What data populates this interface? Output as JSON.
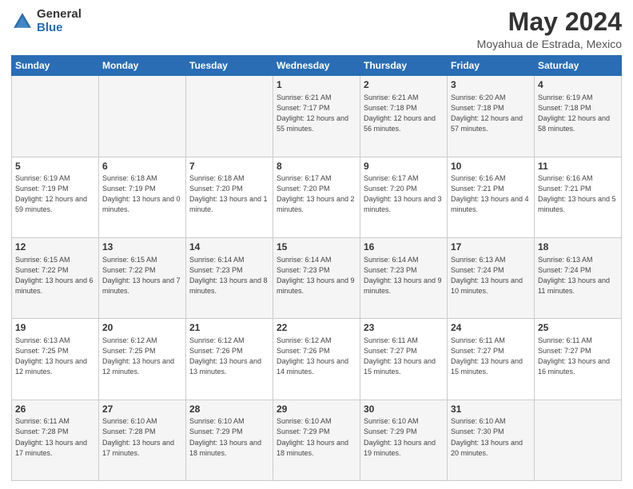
{
  "logo": {
    "general": "General",
    "blue": "Blue"
  },
  "title": "May 2024",
  "subtitle": "Moyahua de Estrada, Mexico",
  "days_header": [
    "Sunday",
    "Monday",
    "Tuesday",
    "Wednesday",
    "Thursday",
    "Friday",
    "Saturday"
  ],
  "weeks": [
    [
      {
        "num": "",
        "sunrise": "",
        "sunset": "",
        "daylight": ""
      },
      {
        "num": "",
        "sunrise": "",
        "sunset": "",
        "daylight": ""
      },
      {
        "num": "",
        "sunrise": "",
        "sunset": "",
        "daylight": ""
      },
      {
        "num": "1",
        "sunrise": "Sunrise: 6:21 AM",
        "sunset": "Sunset: 7:17 PM",
        "daylight": "Daylight: 12 hours and 55 minutes."
      },
      {
        "num": "2",
        "sunrise": "Sunrise: 6:21 AM",
        "sunset": "Sunset: 7:18 PM",
        "daylight": "Daylight: 12 hours and 56 minutes."
      },
      {
        "num": "3",
        "sunrise": "Sunrise: 6:20 AM",
        "sunset": "Sunset: 7:18 PM",
        "daylight": "Daylight: 12 hours and 57 minutes."
      },
      {
        "num": "4",
        "sunrise": "Sunrise: 6:19 AM",
        "sunset": "Sunset: 7:18 PM",
        "daylight": "Daylight: 12 hours and 58 minutes."
      }
    ],
    [
      {
        "num": "5",
        "sunrise": "Sunrise: 6:19 AM",
        "sunset": "Sunset: 7:19 PM",
        "daylight": "Daylight: 12 hours and 59 minutes."
      },
      {
        "num": "6",
        "sunrise": "Sunrise: 6:18 AM",
        "sunset": "Sunset: 7:19 PM",
        "daylight": "Daylight: 13 hours and 0 minutes."
      },
      {
        "num": "7",
        "sunrise": "Sunrise: 6:18 AM",
        "sunset": "Sunset: 7:20 PM",
        "daylight": "Daylight: 13 hours and 1 minute."
      },
      {
        "num": "8",
        "sunrise": "Sunrise: 6:17 AM",
        "sunset": "Sunset: 7:20 PM",
        "daylight": "Daylight: 13 hours and 2 minutes."
      },
      {
        "num": "9",
        "sunrise": "Sunrise: 6:17 AM",
        "sunset": "Sunset: 7:20 PM",
        "daylight": "Daylight: 13 hours and 3 minutes."
      },
      {
        "num": "10",
        "sunrise": "Sunrise: 6:16 AM",
        "sunset": "Sunset: 7:21 PM",
        "daylight": "Daylight: 13 hours and 4 minutes."
      },
      {
        "num": "11",
        "sunrise": "Sunrise: 6:16 AM",
        "sunset": "Sunset: 7:21 PM",
        "daylight": "Daylight: 13 hours and 5 minutes."
      }
    ],
    [
      {
        "num": "12",
        "sunrise": "Sunrise: 6:15 AM",
        "sunset": "Sunset: 7:22 PM",
        "daylight": "Daylight: 13 hours and 6 minutes."
      },
      {
        "num": "13",
        "sunrise": "Sunrise: 6:15 AM",
        "sunset": "Sunset: 7:22 PM",
        "daylight": "Daylight: 13 hours and 7 minutes."
      },
      {
        "num": "14",
        "sunrise": "Sunrise: 6:14 AM",
        "sunset": "Sunset: 7:23 PM",
        "daylight": "Daylight: 13 hours and 8 minutes."
      },
      {
        "num": "15",
        "sunrise": "Sunrise: 6:14 AM",
        "sunset": "Sunset: 7:23 PM",
        "daylight": "Daylight: 13 hours and 9 minutes."
      },
      {
        "num": "16",
        "sunrise": "Sunrise: 6:14 AM",
        "sunset": "Sunset: 7:23 PM",
        "daylight": "Daylight: 13 hours and 9 minutes."
      },
      {
        "num": "17",
        "sunrise": "Sunrise: 6:13 AM",
        "sunset": "Sunset: 7:24 PM",
        "daylight": "Daylight: 13 hours and 10 minutes."
      },
      {
        "num": "18",
        "sunrise": "Sunrise: 6:13 AM",
        "sunset": "Sunset: 7:24 PM",
        "daylight": "Daylight: 13 hours and 11 minutes."
      }
    ],
    [
      {
        "num": "19",
        "sunrise": "Sunrise: 6:13 AM",
        "sunset": "Sunset: 7:25 PM",
        "daylight": "Daylight: 13 hours and 12 minutes."
      },
      {
        "num": "20",
        "sunrise": "Sunrise: 6:12 AM",
        "sunset": "Sunset: 7:25 PM",
        "daylight": "Daylight: 13 hours and 12 minutes."
      },
      {
        "num": "21",
        "sunrise": "Sunrise: 6:12 AM",
        "sunset": "Sunset: 7:26 PM",
        "daylight": "Daylight: 13 hours and 13 minutes."
      },
      {
        "num": "22",
        "sunrise": "Sunrise: 6:12 AM",
        "sunset": "Sunset: 7:26 PM",
        "daylight": "Daylight: 13 hours and 14 minutes."
      },
      {
        "num": "23",
        "sunrise": "Sunrise: 6:11 AM",
        "sunset": "Sunset: 7:27 PM",
        "daylight": "Daylight: 13 hours and 15 minutes."
      },
      {
        "num": "24",
        "sunrise": "Sunrise: 6:11 AM",
        "sunset": "Sunset: 7:27 PM",
        "daylight": "Daylight: 13 hours and 15 minutes."
      },
      {
        "num": "25",
        "sunrise": "Sunrise: 6:11 AM",
        "sunset": "Sunset: 7:27 PM",
        "daylight": "Daylight: 13 hours and 16 minutes."
      }
    ],
    [
      {
        "num": "26",
        "sunrise": "Sunrise: 6:11 AM",
        "sunset": "Sunset: 7:28 PM",
        "daylight": "Daylight: 13 hours and 17 minutes."
      },
      {
        "num": "27",
        "sunrise": "Sunrise: 6:10 AM",
        "sunset": "Sunset: 7:28 PM",
        "daylight": "Daylight: 13 hours and 17 minutes."
      },
      {
        "num": "28",
        "sunrise": "Sunrise: 6:10 AM",
        "sunset": "Sunset: 7:29 PM",
        "daylight": "Daylight: 13 hours and 18 minutes."
      },
      {
        "num": "29",
        "sunrise": "Sunrise: 6:10 AM",
        "sunset": "Sunset: 7:29 PM",
        "daylight": "Daylight: 13 hours and 18 minutes."
      },
      {
        "num": "30",
        "sunrise": "Sunrise: 6:10 AM",
        "sunset": "Sunset: 7:29 PM",
        "daylight": "Daylight: 13 hours and 19 minutes."
      },
      {
        "num": "31",
        "sunrise": "Sunrise: 6:10 AM",
        "sunset": "Sunset: 7:30 PM",
        "daylight": "Daylight: 13 hours and 20 minutes."
      },
      {
        "num": "",
        "sunrise": "",
        "sunset": "",
        "daylight": ""
      }
    ]
  ]
}
